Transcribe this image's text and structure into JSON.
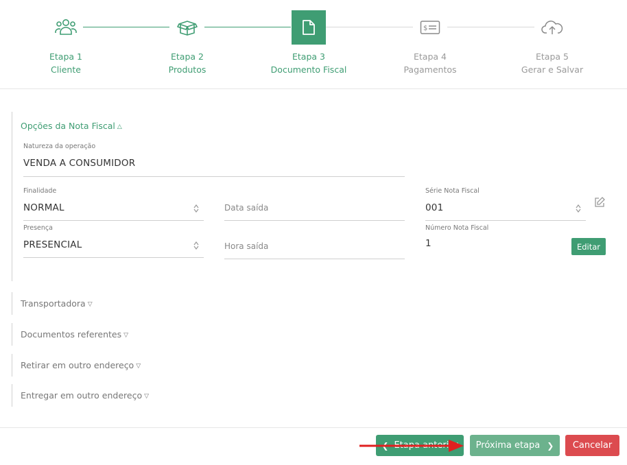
{
  "steps": [
    {
      "number_label": "Etapa 1",
      "name": "Cliente",
      "icon": "users-icon",
      "state": "done"
    },
    {
      "number_label": "Etapa 2",
      "name": "Produtos",
      "icon": "box-icon",
      "state": "done"
    },
    {
      "number_label": "Etapa 3",
      "name": "Documento Fiscal",
      "icon": "document-icon",
      "state": "current"
    },
    {
      "number_label": "Etapa 4",
      "name": "Pagamentos",
      "icon": "money-icon",
      "state": "pending"
    },
    {
      "number_label": "Etapa 5",
      "name": "Gerar e Salvar",
      "icon": "cloud-upload-icon",
      "state": "pending"
    }
  ],
  "invoice_options": {
    "title": "Opções da Nota Fiscal",
    "natureza": {
      "label": "Natureza da operação",
      "value": "VENDA A CONSUMIDOR"
    },
    "finalidade": {
      "label": "Finalidade",
      "value": "NORMAL"
    },
    "presenca": {
      "label": "Presença",
      "value": "PRESENCIAL"
    },
    "data_saida": {
      "placeholder": "Data saída"
    },
    "hora_saida": {
      "placeholder": "Hora saída"
    },
    "serie": {
      "label": "Série Nota Fiscal",
      "value": "001"
    },
    "numero": {
      "label": "Número Nota Fiscal",
      "value": "1"
    },
    "edit_button": "Editar"
  },
  "collapsed_sections": [
    {
      "title": "Transportadora"
    },
    {
      "title": "Documentos referentes"
    },
    {
      "title": "Retirar em outro endereço"
    },
    {
      "title": "Entregar em outro endereço"
    }
  ],
  "footer": {
    "prev_label": "Etapa anterior",
    "next_label": "Próxima etapa",
    "cancel_label": "Cancelar"
  },
  "colors": {
    "accent": "#3f9d73",
    "danger": "#dc4b4f",
    "annotation_arrow": "#e02020"
  }
}
